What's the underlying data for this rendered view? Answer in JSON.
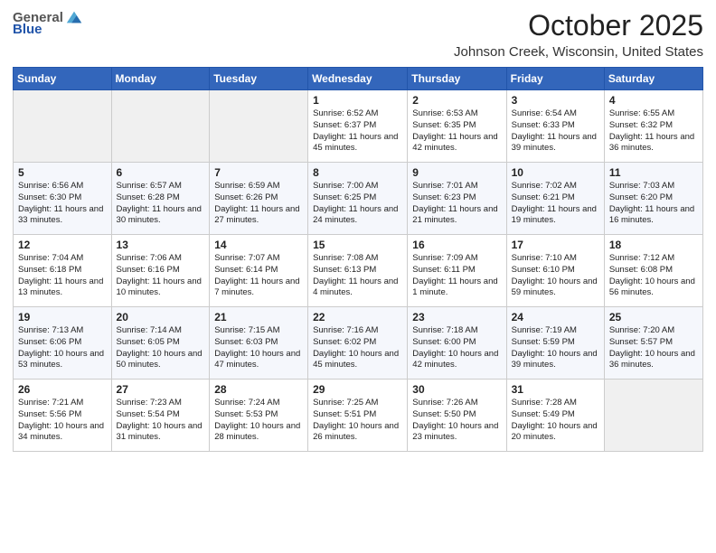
{
  "header": {
    "logo_general": "General",
    "logo_blue": "Blue",
    "month": "October 2025",
    "location": "Johnson Creek, Wisconsin, United States"
  },
  "days_of_week": [
    "Sunday",
    "Monday",
    "Tuesday",
    "Wednesday",
    "Thursday",
    "Friday",
    "Saturday"
  ],
  "weeks": [
    [
      {
        "day": "",
        "info": ""
      },
      {
        "day": "",
        "info": ""
      },
      {
        "day": "",
        "info": ""
      },
      {
        "day": "1",
        "info": "Sunrise: 6:52 AM\nSunset: 6:37 PM\nDaylight: 11 hours and 45 minutes."
      },
      {
        "day": "2",
        "info": "Sunrise: 6:53 AM\nSunset: 6:35 PM\nDaylight: 11 hours and 42 minutes."
      },
      {
        "day": "3",
        "info": "Sunrise: 6:54 AM\nSunset: 6:33 PM\nDaylight: 11 hours and 39 minutes."
      },
      {
        "day": "4",
        "info": "Sunrise: 6:55 AM\nSunset: 6:32 PM\nDaylight: 11 hours and 36 minutes."
      }
    ],
    [
      {
        "day": "5",
        "info": "Sunrise: 6:56 AM\nSunset: 6:30 PM\nDaylight: 11 hours and 33 minutes."
      },
      {
        "day": "6",
        "info": "Sunrise: 6:57 AM\nSunset: 6:28 PM\nDaylight: 11 hours and 30 minutes."
      },
      {
        "day": "7",
        "info": "Sunrise: 6:59 AM\nSunset: 6:26 PM\nDaylight: 11 hours and 27 minutes."
      },
      {
        "day": "8",
        "info": "Sunrise: 7:00 AM\nSunset: 6:25 PM\nDaylight: 11 hours and 24 minutes."
      },
      {
        "day": "9",
        "info": "Sunrise: 7:01 AM\nSunset: 6:23 PM\nDaylight: 11 hours and 21 minutes."
      },
      {
        "day": "10",
        "info": "Sunrise: 7:02 AM\nSunset: 6:21 PM\nDaylight: 11 hours and 19 minutes."
      },
      {
        "day": "11",
        "info": "Sunrise: 7:03 AM\nSunset: 6:20 PM\nDaylight: 11 hours and 16 minutes."
      }
    ],
    [
      {
        "day": "12",
        "info": "Sunrise: 7:04 AM\nSunset: 6:18 PM\nDaylight: 11 hours and 13 minutes."
      },
      {
        "day": "13",
        "info": "Sunrise: 7:06 AM\nSunset: 6:16 PM\nDaylight: 11 hours and 10 minutes."
      },
      {
        "day": "14",
        "info": "Sunrise: 7:07 AM\nSunset: 6:14 PM\nDaylight: 11 hours and 7 minutes."
      },
      {
        "day": "15",
        "info": "Sunrise: 7:08 AM\nSunset: 6:13 PM\nDaylight: 11 hours and 4 minutes."
      },
      {
        "day": "16",
        "info": "Sunrise: 7:09 AM\nSunset: 6:11 PM\nDaylight: 11 hours and 1 minute."
      },
      {
        "day": "17",
        "info": "Sunrise: 7:10 AM\nSunset: 6:10 PM\nDaylight: 10 hours and 59 minutes."
      },
      {
        "day": "18",
        "info": "Sunrise: 7:12 AM\nSunset: 6:08 PM\nDaylight: 10 hours and 56 minutes."
      }
    ],
    [
      {
        "day": "19",
        "info": "Sunrise: 7:13 AM\nSunset: 6:06 PM\nDaylight: 10 hours and 53 minutes."
      },
      {
        "day": "20",
        "info": "Sunrise: 7:14 AM\nSunset: 6:05 PM\nDaylight: 10 hours and 50 minutes."
      },
      {
        "day": "21",
        "info": "Sunrise: 7:15 AM\nSunset: 6:03 PM\nDaylight: 10 hours and 47 minutes."
      },
      {
        "day": "22",
        "info": "Sunrise: 7:16 AM\nSunset: 6:02 PM\nDaylight: 10 hours and 45 minutes."
      },
      {
        "day": "23",
        "info": "Sunrise: 7:18 AM\nSunset: 6:00 PM\nDaylight: 10 hours and 42 minutes."
      },
      {
        "day": "24",
        "info": "Sunrise: 7:19 AM\nSunset: 5:59 PM\nDaylight: 10 hours and 39 minutes."
      },
      {
        "day": "25",
        "info": "Sunrise: 7:20 AM\nSunset: 5:57 PM\nDaylight: 10 hours and 36 minutes."
      }
    ],
    [
      {
        "day": "26",
        "info": "Sunrise: 7:21 AM\nSunset: 5:56 PM\nDaylight: 10 hours and 34 minutes."
      },
      {
        "day": "27",
        "info": "Sunrise: 7:23 AM\nSunset: 5:54 PM\nDaylight: 10 hours and 31 minutes."
      },
      {
        "day": "28",
        "info": "Sunrise: 7:24 AM\nSunset: 5:53 PM\nDaylight: 10 hours and 28 minutes."
      },
      {
        "day": "29",
        "info": "Sunrise: 7:25 AM\nSunset: 5:51 PM\nDaylight: 10 hours and 26 minutes."
      },
      {
        "day": "30",
        "info": "Sunrise: 7:26 AM\nSunset: 5:50 PM\nDaylight: 10 hours and 23 minutes."
      },
      {
        "day": "31",
        "info": "Sunrise: 7:28 AM\nSunset: 5:49 PM\nDaylight: 10 hours and 20 minutes."
      },
      {
        "day": "",
        "info": ""
      }
    ]
  ]
}
